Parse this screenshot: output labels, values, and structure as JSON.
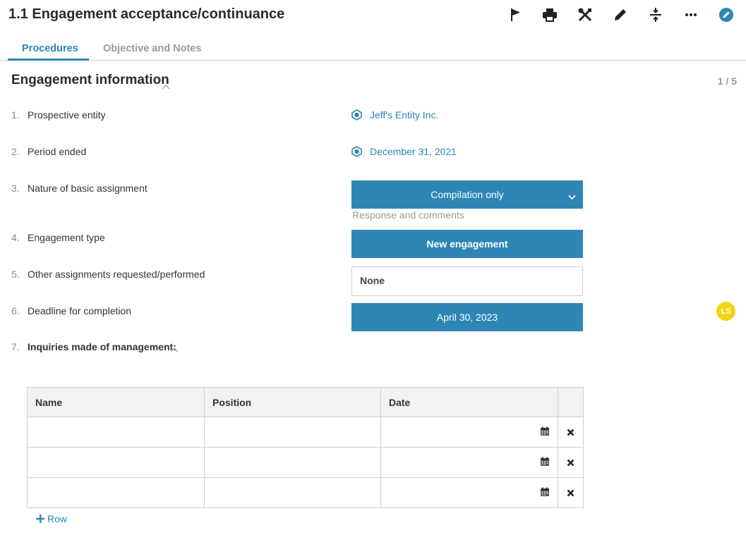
{
  "header": {
    "title": "1.1 Engagement acceptance/continuance",
    "toolbar_icons": [
      "flag-icon",
      "print-icon",
      "tools-icon",
      "pencil-icon",
      "collapse-icon",
      "more-icon",
      "edit-circle-icon"
    ]
  },
  "tabs": [
    {
      "label": "Procedures",
      "active": true
    },
    {
      "label": "Objective and Notes",
      "active": false
    }
  ],
  "section": {
    "title": "Engagement information",
    "pager": "1 / 5"
  },
  "questions": [
    {
      "num": "1.",
      "label": "Prospective entity",
      "answer": "Jeff's Entity Inc."
    },
    {
      "num": "2.",
      "label": "Period ended",
      "answer": "December 31, 2021"
    },
    {
      "num": "3.",
      "label": "Nature of basic assignment",
      "answer": "Compilation only",
      "note": "Response and comments"
    },
    {
      "num": "4.",
      "label": "Engagement type",
      "answer": "New engagement"
    },
    {
      "num": "5.",
      "label": "Other assignments requested/performed",
      "answer": "None"
    },
    {
      "num": "6.",
      "label": "Deadline for completion",
      "answer": "April 30, 2023"
    },
    {
      "num": "7.",
      "label": "Inquiries made of management:"
    }
  ],
  "avatar": {
    "initials": "LS",
    "color": "#f5d313"
  },
  "table": {
    "headers": [
      "Name",
      "Position",
      "Date",
      ""
    ],
    "rows": [
      {
        "name": "",
        "position": "",
        "date": ""
      },
      {
        "name": "",
        "position": "",
        "date": ""
      },
      {
        "name": "",
        "position": "",
        "date": ""
      }
    ],
    "add_row_label": "Row"
  },
  "colors": {
    "accent": "#2e86b5",
    "avatar": "#f5d313",
    "header_bg": "#f2f2f2"
  }
}
